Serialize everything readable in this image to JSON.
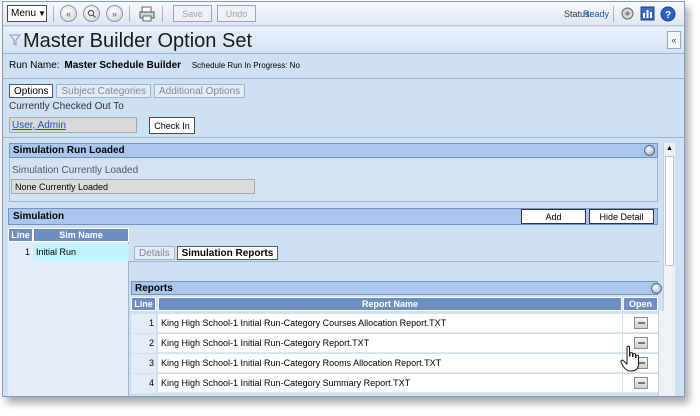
{
  "toolbar": {
    "menu_label": "Menu",
    "save_label": "Save",
    "undo_label": "Undo",
    "status_label": "Status:",
    "status_value": "Ready"
  },
  "header": {
    "title": "Master Builder Option Set",
    "collapse_label": "«"
  },
  "run": {
    "label": "Run Name:",
    "value": "Master Schedule Builder",
    "progress": "Schedule Run In Progress: No"
  },
  "tabs": [
    {
      "label": "Options"
    },
    {
      "label": "Subject Categories"
    },
    {
      "label": "Additional Options"
    }
  ],
  "checkout": {
    "label": "Currently Checked Out To",
    "user": "User, Admin",
    "checkin_label": "Check In"
  },
  "simulation_run_loaded": {
    "header": "Simulation Run Loaded",
    "field_label": "Simulation Currently Loaded",
    "field_value": "None Currently Loaded"
  },
  "simulation": {
    "header": "Simulation",
    "add_label": "Add",
    "hide_detail_label": "Hide Detail",
    "list_headers": {
      "line": "Line",
      "sim_name": "Sim Name"
    },
    "rows": [
      {
        "line": "1",
        "name": "Initial Run"
      }
    ]
  },
  "detail_tabs": [
    {
      "label": "Details"
    },
    {
      "label": "Simulation Reports"
    }
  ],
  "reports": {
    "header": "Reports",
    "columns": {
      "line": "Line",
      "name": "Report Name",
      "open": "Open"
    },
    "rows": [
      {
        "line": "1",
        "name": "King High School-1 Initial Run-Category Courses Allocation Report.TXT"
      },
      {
        "line": "2",
        "name": "King High School-1 Initial Run-Category Report.TXT"
      },
      {
        "line": "3",
        "name": "King High School-1 Initial Run-Category Rooms Allocation Report.TXT"
      },
      {
        "line": "4",
        "name": "King High School-1 Initial Run-Category Summary Report.TXT"
      }
    ]
  },
  "colors": {
    "section_header": "#a9c7ec",
    "column_header": "#6d8fc0",
    "selected_row": "#bff4fb",
    "status_ready": "#1b52c4"
  }
}
